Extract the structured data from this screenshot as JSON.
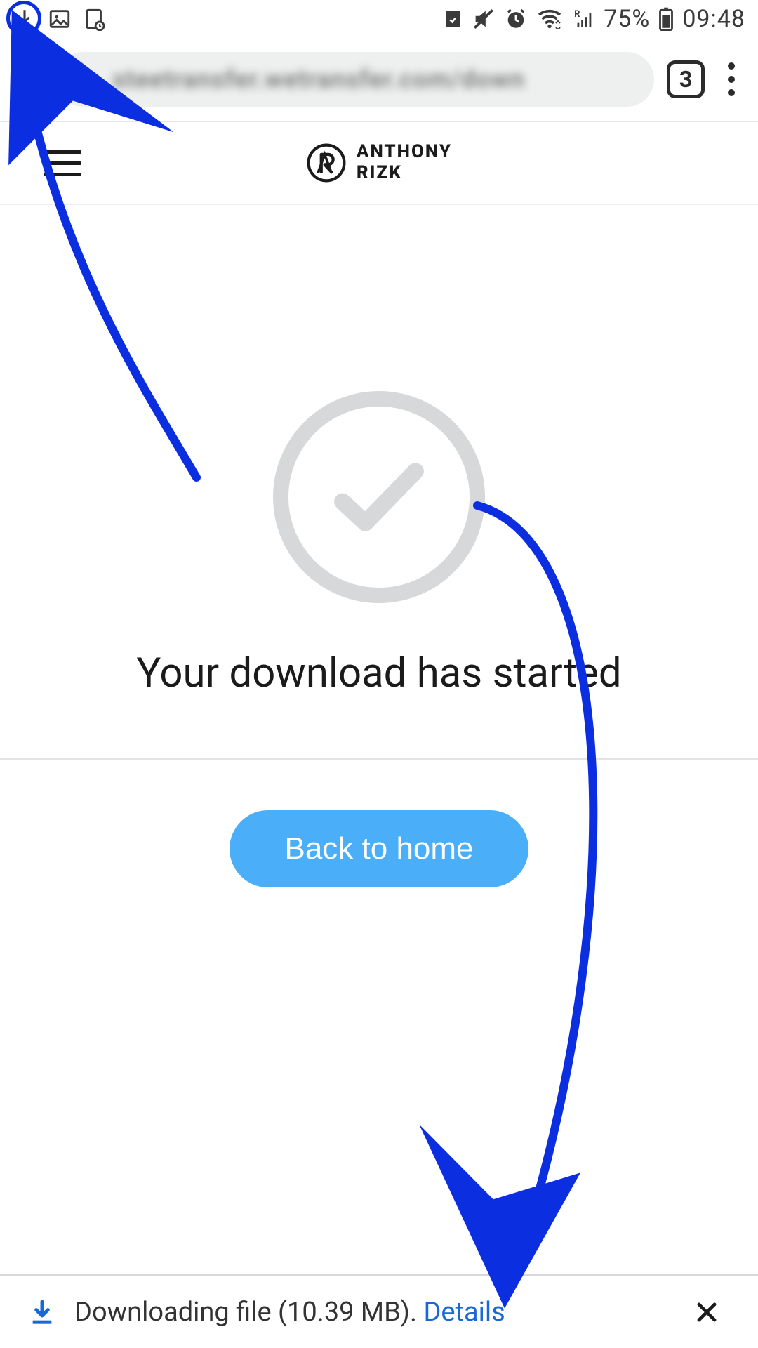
{
  "status": {
    "battery_pct": "75%",
    "time": "09:48"
  },
  "browser": {
    "url_display": "steetransfer.wetransfer.com/down",
    "tab_count": "3"
  },
  "site": {
    "logo_line1": "ANTHONY",
    "logo_line2": "RIZK"
  },
  "main": {
    "headline": "Your download has started",
    "cta_label": "Back to home"
  },
  "snackbar": {
    "text": "Downloading file (10.39 MB). ",
    "link": "Details"
  }
}
